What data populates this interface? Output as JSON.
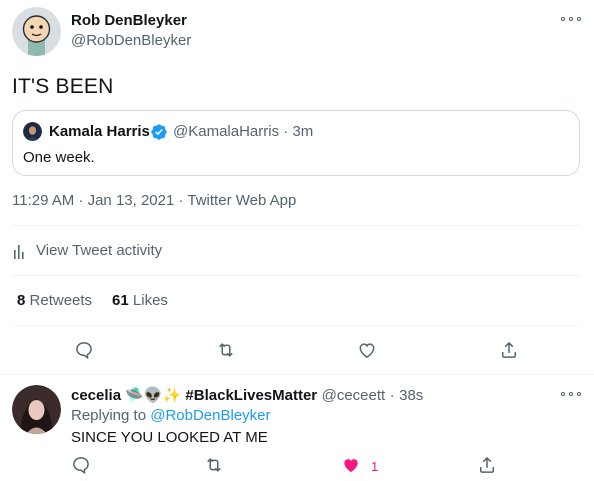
{
  "tweet": {
    "author_name": "Rob DenBleyker",
    "author_handle": "@RobDenBleyker",
    "text": "IT'S BEEN",
    "quote": {
      "author_name": "Kamala Harris",
      "author_handle": "@KamalaHarris",
      "separator": "·",
      "time": "3m",
      "text": "One week.",
      "verified": true
    },
    "timestamp": "11:29 AM · Jan 13, 2021 · Twitter Web App",
    "activity_label": "View Tweet activity",
    "retweets_count": "8",
    "retweets_label": "Retweets",
    "likes_count": "61",
    "likes_label": "Likes"
  },
  "reply": {
    "author_name": "cecelia 🛸👽✨ #BlackLivesMatter",
    "author_handle": "@ceceett",
    "separator": "·",
    "time": "38s",
    "replying_to_label": "Replying to",
    "replying_to_handle": "@RobDenBleyker",
    "text": "SINCE YOU LOOKED AT ME",
    "like_count": "1"
  },
  "icons": {
    "more": "more-horizontal-icon",
    "reply": "reply-icon",
    "retweet": "retweet-icon",
    "like": "heart-icon",
    "share": "share-icon",
    "activity": "bar-chart-icon",
    "verified": "verified-badge-icon"
  },
  "colors": {
    "accent": "#1d9bf0",
    "like": "#f91880",
    "muted_text": "#536471",
    "divider": "#eff3f4"
  }
}
